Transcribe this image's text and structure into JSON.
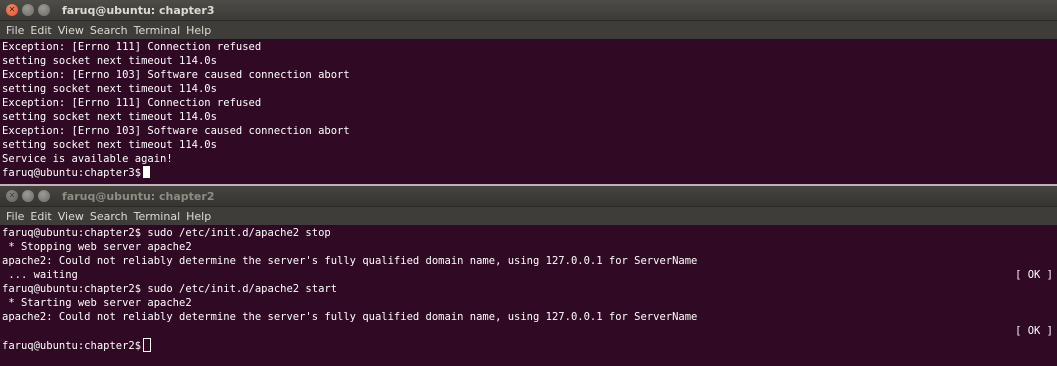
{
  "window1": {
    "title": "faruq@ubuntu: chapter3",
    "menu": [
      "File",
      "Edit",
      "View",
      "Search",
      "Terminal",
      "Help"
    ],
    "lines": [
      "Exception: [Errno 111] Connection refused",
      "setting socket next timeout 114.0s",
      "Exception: [Errno 103] Software caused connection abort",
      "setting socket next timeout 114.0s",
      "Exception: [Errno 111] Connection refused",
      "setting socket next timeout 114.0s",
      "Exception: [Errno 103] Software caused connection abort",
      "setting socket next timeout 114.0s",
      "Service is available again!"
    ],
    "prompt": "faruq@ubuntu:chapter3$"
  },
  "window2": {
    "title": "faruq@ubuntu: chapter2",
    "menu": [
      "File",
      "Edit",
      "View",
      "Search",
      "Terminal",
      "Help"
    ],
    "lines": [
      {
        "text": "faruq@ubuntu:chapter2$ sudo /etc/init.d/apache2 stop",
        "status": ""
      },
      {
        "text": " * Stopping web server apache2",
        "status": ""
      },
      {
        "text": "apache2: Could not reliably determine the server's fully qualified domain name, using 127.0.0.1 for ServerName",
        "status": ""
      },
      {
        "text": " ... waiting",
        "status": "[ OK ]"
      },
      {
        "text": "faruq@ubuntu:chapter2$ sudo /etc/init.d/apache2 start",
        "status": ""
      },
      {
        "text": " * Starting web server apache2",
        "status": ""
      },
      {
        "text": "apache2: Could not reliably determine the server's fully qualified domain name, using 127.0.0.1 for ServerName",
        "status": ""
      },
      {
        "text": "",
        "status": "[ OK ]"
      }
    ],
    "prompt": "faruq@ubuntu:chapter2$"
  },
  "colors": {
    "terminal_bg": "#300a24",
    "terminal_fg": "#ffffff",
    "titlebar": "#3c3b37",
    "close_button": "#e0512b"
  }
}
